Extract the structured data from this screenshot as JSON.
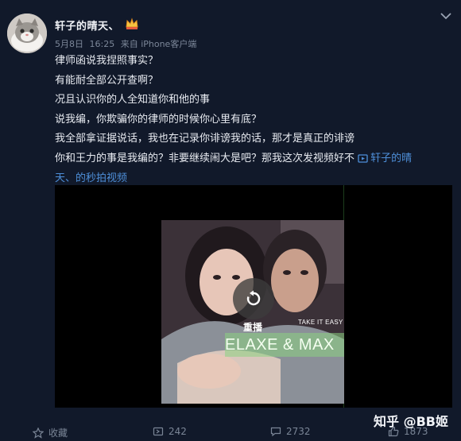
{
  "post": {
    "username": "轩子的晴天、",
    "vip_icon": "crown-badge-icon",
    "date": "5月8日",
    "time": "16:25",
    "source_label": "来自 iPhone客户端",
    "content_lines": [
      "律师函说我捏照事实？",
      "有能耐全部公开查啊？",
      "况且认识你的人全知道你和他的事",
      "说我编，你欺骗你的律师的时候你心里有底？",
      "我全部拿证据说话，我也在记录你诽谤我的话，那才是真正的诽谤",
      "你和王力的事是我编的？非要继续闹大是吧？那我这次发视频好不"
    ],
    "video_link_head": "轩子的晴",
    "video_link_tail": "天、的秒拍视频"
  },
  "video": {
    "replay_label": "重播",
    "overlay_caption": "TAKE IT EASY",
    "overlay_title": "ELAXE & MAX"
  },
  "footer": {
    "favorite_label": "收藏",
    "repost_count": "242",
    "comment_count": "2732",
    "like_count": "1873",
    "watermark": "知乎 @BB姬"
  },
  "colors": {
    "background": "#11192a",
    "link": "#4e8fd9",
    "meta": "#7c8799"
  }
}
